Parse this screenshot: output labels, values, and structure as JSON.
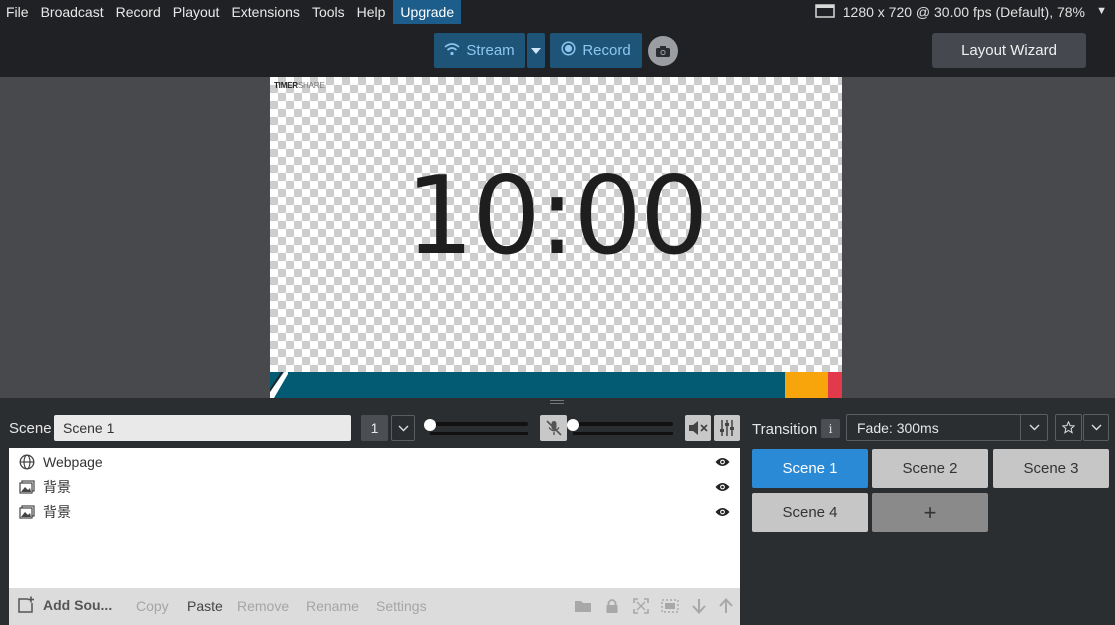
{
  "menubar": {
    "items": [
      "File",
      "Broadcast",
      "Record",
      "Playout",
      "Extensions",
      "Tools",
      "Help"
    ],
    "upgrade_label": "Upgrade",
    "resolution_text": "1280 x 720 @ 30.00 fps (Default), 78%"
  },
  "toolbar": {
    "stream_label": "Stream",
    "record_label": "Record",
    "layout_wizard_label": "Layout Wizard"
  },
  "preview": {
    "brand_a": "TIMER",
    "brand_b": "SHARE",
    "timer_text": "10:00",
    "colors": {
      "bar_main": "#035a73",
      "bar_orange": "#f7a50a",
      "bar_red": "#e33a4b"
    }
  },
  "scene_bar": {
    "label": "Scene",
    "current_scene": "Scene 1",
    "scene_number": "1"
  },
  "sources": [
    {
      "name": "Webpage",
      "icon": "globe-icon"
    },
    {
      "name": "背景",
      "icon": "image-icon"
    },
    {
      "name": "背景",
      "icon": "image-icon"
    }
  ],
  "sources_toolbar": {
    "add_label": "Add Sou...",
    "copy_label": "Copy",
    "paste_label": "Paste",
    "remove_label": "Remove",
    "rename_label": "Rename",
    "settings_label": "Settings"
  },
  "transition": {
    "label": "Transition",
    "info_glyph": "i",
    "value": "Fade: 300ms"
  },
  "scenes": {
    "items": [
      "Scene 1",
      "Scene 2",
      "Scene 3",
      "Scene 4"
    ],
    "active": "Scene 1",
    "add_label": "+"
  },
  "accent_color": "#2b8ad6"
}
